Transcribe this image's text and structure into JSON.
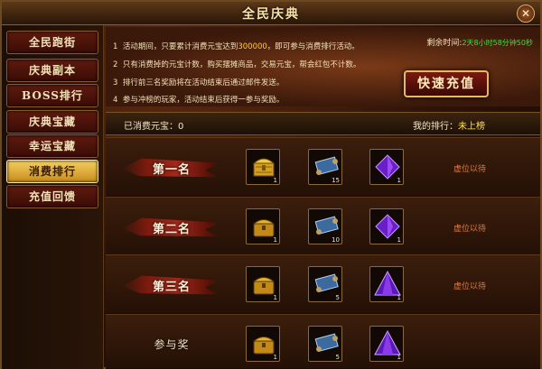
{
  "window": {
    "title": "全民庆典",
    "close_icon": "close-icon"
  },
  "sidebar": {
    "items": [
      {
        "label": "全民跑街",
        "active": false
      },
      {
        "label": "庆典副本",
        "active": false
      },
      {
        "label": "BOSS排行",
        "active": false
      },
      {
        "label": "庆典宝藏",
        "active": false
      },
      {
        "label": "幸运宝藏",
        "active": false
      },
      {
        "label": "消费排行",
        "active": true
      },
      {
        "label": "充值回馈",
        "active": false
      }
    ]
  },
  "info": {
    "rules": [
      {
        "num": "1",
        "before": "活动期间，只要累计消费元宝达到",
        "highlight": "300000",
        "after": "，即可参与消费排行活动。"
      },
      {
        "num": "2",
        "before": "只有消费掉的元宝计数，购买摆摊商品，交易元宝，帮会红包不计数。",
        "highlight": "",
        "after": ""
      },
      {
        "num": "3",
        "before": "排行前三名奖励将在活动结束后通过邮件发送。",
        "highlight": "",
        "after": ""
      },
      {
        "num": "4",
        "before": "参与冲榜的玩家，活动结束后获得一参与奖励。",
        "highlight": "",
        "after": ""
      }
    ],
    "countdown_label": "剩余时间:",
    "countdown_value": "2天8小时58分钟50秒",
    "quick_recharge_label": "快速充值"
  },
  "stats": {
    "consumed_label": "已消费元宝：",
    "consumed_value": "0",
    "my_rank_label": "我的排行：",
    "my_rank_value": "未上榜"
  },
  "rewards": [
    {
      "rank": "第一名",
      "items": [
        {
          "icon": "golden-chest-icon",
          "count": "1"
        },
        {
          "icon": "scroll-icon",
          "count": "15"
        },
        {
          "icon": "purple-crystal-icon",
          "count": "1"
        }
      ],
      "status": "虚位以待"
    },
    {
      "rank": "第二名",
      "items": [
        {
          "icon": "treasure-chest-icon",
          "count": "1"
        },
        {
          "icon": "scroll-icon",
          "count": "10"
        },
        {
          "icon": "purple-crystal-icon",
          "count": "1"
        }
      ],
      "status": "虚位以待"
    },
    {
      "rank": "第三名",
      "items": [
        {
          "icon": "treasure-chest-icon",
          "count": "1"
        },
        {
          "icon": "scroll-icon",
          "count": "5"
        },
        {
          "icon": "purple-prism-icon",
          "count": "1"
        }
      ],
      "status": "虚位以待"
    },
    {
      "rank": "参与奖",
      "items": [
        {
          "icon": "treasure-chest-icon",
          "count": "1"
        },
        {
          "icon": "scroll-icon",
          "count": "5"
        },
        {
          "icon": "purple-prism-icon",
          "count": "1"
        }
      ],
      "status": ""
    }
  ],
  "colors": {
    "accent_gold": "#ffe04a",
    "status_orange": "#e07a3a",
    "countdown_green": "#44dd44",
    "highlight_yellow": "#ffcc33"
  }
}
